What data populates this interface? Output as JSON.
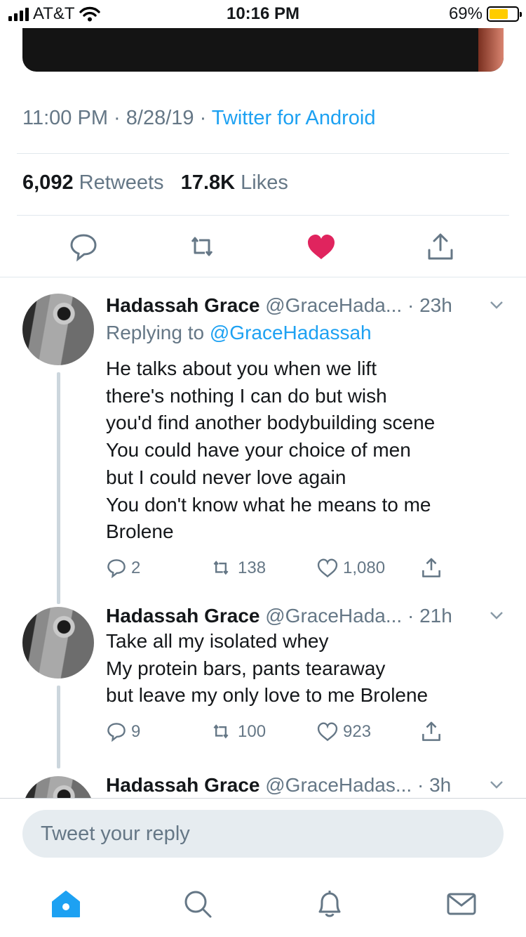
{
  "status_bar": {
    "carrier": "AT&T",
    "time": "10:16 PM",
    "battery": "69%",
    "battery_level": 0.69
  },
  "tweet": {
    "time": "11:00 PM",
    "date": "8/28/19",
    "source": "Twitter for Android",
    "retweets_count": "6,092",
    "retweets_label": "Retweets",
    "likes_count": "17.8K",
    "likes_label": "Likes",
    "liked": true,
    "colors": {
      "link": "#1da1f2",
      "like": "#e0245e",
      "muted": "#657786"
    }
  },
  "replies": [
    {
      "name": "Hadassah Grace",
      "handle": "@GraceHada...",
      "time": "23h",
      "replying_prefix": "Replying to",
      "replying_to": "@GraceHadassah",
      "lines": [
        "He talks about you when we lift",
        "there's nothing I can do but wish",
        "you'd find another bodybuilding scene",
        "You could have your choice of men",
        "but I could never love again",
        "You don't know what he means to me",
        "Brolene"
      ],
      "replies": "2",
      "retweets": "138",
      "likes": "1,080"
    },
    {
      "name": "Hadassah Grace",
      "handle": "@GraceHada...",
      "time": "21h",
      "lines": [
        "Take all my isolated whey",
        "My protein bars, pants tearaway",
        "but leave my only love to me Brolene"
      ],
      "replies": "9",
      "retweets": "100",
      "likes": "923"
    },
    {
      "name": "Hadassah Grace",
      "handle": "@GraceHadas...",
      "time": "3h"
    }
  ],
  "compose": {
    "placeholder": "Tweet your reply"
  },
  "tabbar": {
    "items": [
      "home-icon",
      "search-icon",
      "notifications-icon",
      "messages-icon"
    ],
    "active": "home-icon"
  }
}
